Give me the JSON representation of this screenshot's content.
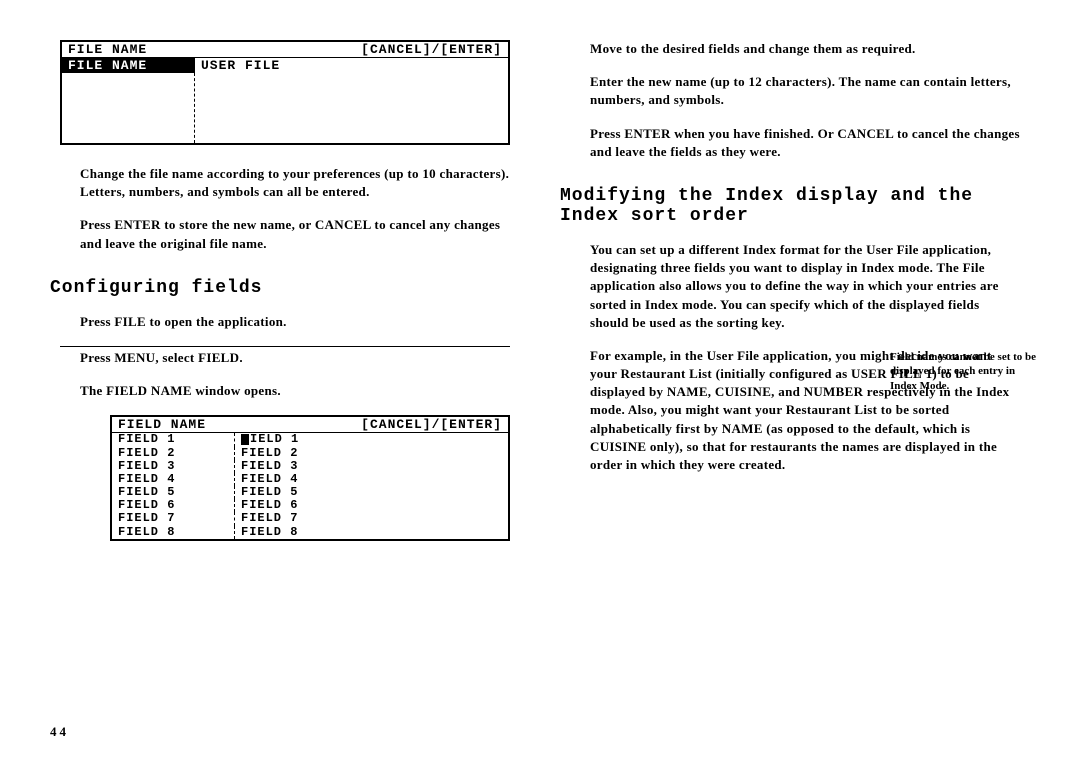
{
  "screen1": {
    "title_left": "FILE NAME",
    "title_right": "[CANCEL]/[ENTER]",
    "label": "FILE NAME",
    "value": "USER FILE"
  },
  "para1": "Change the file name according to your preferences (up to 10 characters). Letters, numbers, and symbols can all be entered.",
  "para2": "Press ENTER to store the new name, or CANCEL to cancel any changes and leave the original file name.",
  "heading1": "Configuring fields",
  "para3": "Press FILE to open the application.",
  "para4": "Press MENU, select FIELD.",
  "para5": "The FIELD NAME window opens.",
  "screen2": {
    "title_left": "FIELD NAME",
    "title_right": "[CANCEL]/[ENTER]",
    "rows": [
      {
        "l": "FIELD 1",
        "r": "IELD 1",
        "cursor": true
      },
      {
        "l": "FIELD 2",
        "r": "FIELD 2"
      },
      {
        "l": "FIELD 3",
        "r": "FIELD 3"
      },
      {
        "l": "FIELD 4",
        "r": "FIELD 4"
      },
      {
        "l": "FIELD 5",
        "r": "FIELD 5"
      },
      {
        "l": "FIELD 6",
        "r": "FIELD 6"
      },
      {
        "l": "FIELD 7",
        "r": "FIELD 7"
      },
      {
        "l": "FIELD 8",
        "r": "FIELD 8"
      }
    ]
  },
  "rcol": {
    "p1": "Move to the desired fields and change them as required.",
    "p2": "Enter the new name (up to 12 characters). The name can contain letters, numbers, and symbols.",
    "p3": "Press ENTER when you have finished. Or CANCEL to cancel the changes and leave the fields as they were.",
    "heading": "Modifying the Index display and the Index sort order",
    "p4": "You can set up a different Index format for the User File application, designating three fields you want to display in Index mode. The File application also allows you to define the way in which your entries are sorted in Index mode. You can specify which of the displayed fields should be used as the sorting key.",
    "p5": "For example, in the User File application, you might decide you want your Restaurant List (initially configured as USER FILE 1) to be displayed by NAME, CUISINE, and NUMBER respectively in the Index mode. Also, you might want your Restaurant List to be sorted alphabetically first by NAME (as opposed to the default, which is CUISINE only), so that for restaurants the names are displayed in the order in which they were created.",
    "sidenote": "Field names cannot be set to be displayed for each entry in Index Mode."
  },
  "page_number": "44"
}
